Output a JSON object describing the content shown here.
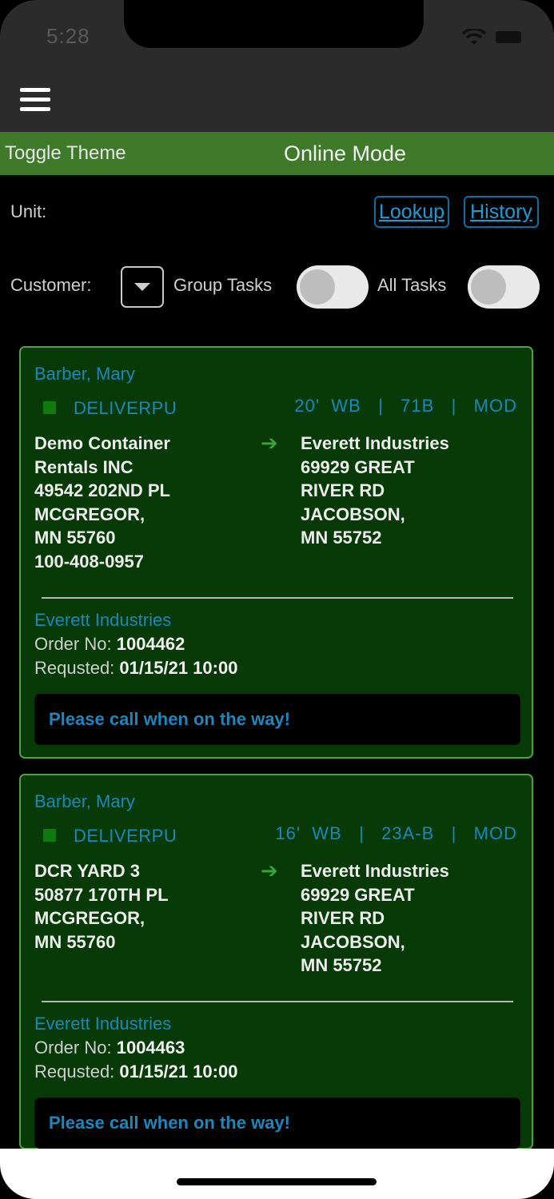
{
  "status_bar": {
    "time": "5:28"
  },
  "header": {
    "toggle_theme": "Toggle Theme",
    "mode": "Online Mode"
  },
  "filters": {
    "unit_label": "Unit:",
    "lookup": "Lookup",
    "history": "History",
    "customer_label": "Customer:",
    "group_tasks_label": "Group Tasks",
    "group_tasks_on": false,
    "all_tasks_label": "All Tasks",
    "all_tasks_on": false
  },
  "tasks": [
    {
      "driver": "Barber, Mary",
      "type": "DELIVERPU",
      "tags": "20'  WB   |   71B   |   MOD",
      "from": [
        "Demo Container",
        "Rentals INC",
        "49542 202ND PL",
        "MCGREGOR,",
        "MN 55760",
        "100-408-0957"
      ],
      "to": [
        "Everett Industries",
        "69929 GREAT",
        "RIVER RD",
        "JACOBSON,",
        "MN 55752"
      ],
      "company": "Everett Industries",
      "order_label": "Order No:",
      "order_no": "1004462",
      "requested_label": "Requsted:",
      "requested": "01/15/21 10:00",
      "note": "Please call when on the way!"
    },
    {
      "driver": "Barber, Mary",
      "type": "DELIVERPU",
      "tags": "16'  WB   |   23A-B   |   MOD",
      "from": [
        "DCR YARD 3",
        "50877 170TH PL",
        "MCGREGOR,",
        "MN 55760"
      ],
      "to": [
        "Everett Industries",
        "69929 GREAT",
        "RIVER RD",
        "JACOBSON,",
        "MN 55752"
      ],
      "company": "Everett Industries",
      "order_label": "Order No:",
      "order_no": "1004463",
      "requested_label": "Requsted:",
      "requested": "01/15/21 10:00",
      "note": "Please call when on the way!"
    }
  ]
}
